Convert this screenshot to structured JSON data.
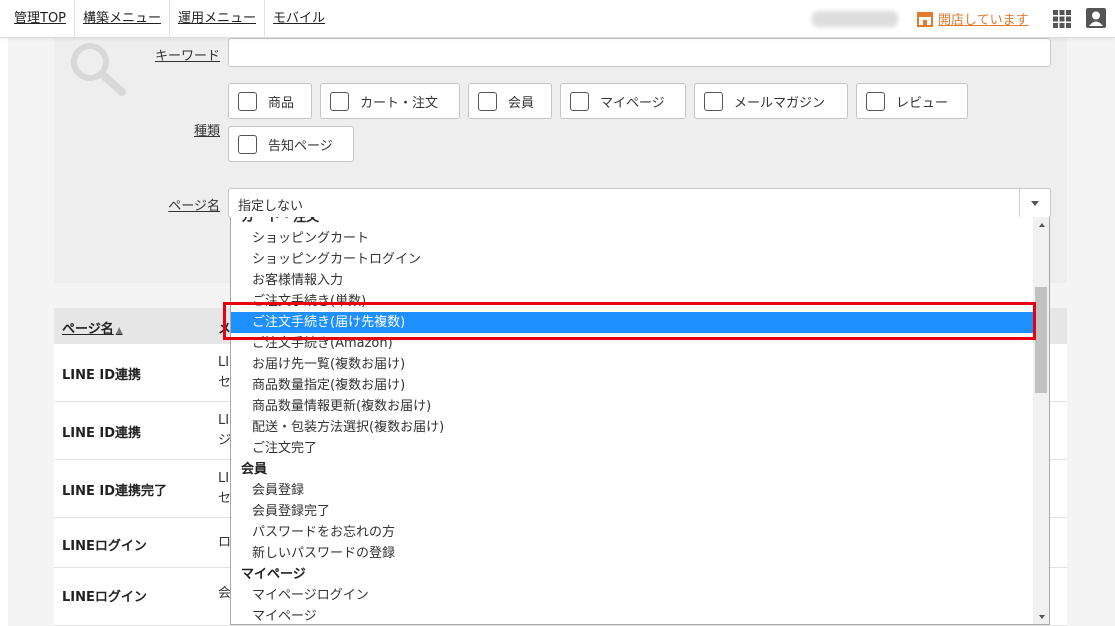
{
  "nav": {
    "items": [
      "管理TOP",
      "構築メニュー",
      "運用メニュー",
      "モバイル"
    ]
  },
  "header": {
    "status": "開店しています",
    "status_color": "#e07a2f"
  },
  "search": {
    "keyword_label": "キーワード",
    "keyword_value": "",
    "type_label": "種類",
    "types": [
      "商品",
      "カート・注文",
      "会員",
      "マイページ",
      "メールマガジン",
      "レビュー",
      "告知ページ"
    ],
    "page_label": "ページ名",
    "page_value": "指定しない"
  },
  "dropdown": {
    "items": [
      {
        "label": "カート・注文",
        "group": true
      },
      {
        "label": "ショッピングカート"
      },
      {
        "label": "ショッピングカートログイン"
      },
      {
        "label": "お客様情報入力"
      },
      {
        "label": "ご注文手続き(単数)"
      },
      {
        "label": "ご注文手続き(届け先複数)",
        "selected": true
      },
      {
        "label": "ご注文手続き(Amazon)"
      },
      {
        "label": "お届け先一覧(複数お届け)"
      },
      {
        "label": "商品数量指定(複数お届け)"
      },
      {
        "label": "商品数量情報更新(複数お届け)"
      },
      {
        "label": "配送・包装方法選択(複数お届け)"
      },
      {
        "label": "ご注文完了"
      },
      {
        "label": "会員",
        "group": true
      },
      {
        "label": "会員登録"
      },
      {
        "label": "会員登録完了"
      },
      {
        "label": "パスワードをお忘れの方"
      },
      {
        "label": "新しいパスワードの登録"
      },
      {
        "label": "マイページ",
        "group": true
      },
      {
        "label": "マイページログイン"
      },
      {
        "label": "マイページ"
      }
    ],
    "highlight_color": "#1e90ff"
  },
  "table": {
    "header_page": "ページ名",
    "header_sort": "▲",
    "header_ex": "メ",
    "rows": [
      {
        "name": "LINE ID連携",
        "desc": "LIセ"
      },
      {
        "name": "LINE ID連携",
        "desc": "LIジ"
      },
      {
        "name": "LINE ID連携完了",
        "desc": "LIセ"
      },
      {
        "name": "LINEログイン",
        "desc": "ロ"
      },
      {
        "name": "LINEログイン",
        "desc": "会"
      }
    ]
  },
  "annotation": {
    "color": "#e60012"
  }
}
